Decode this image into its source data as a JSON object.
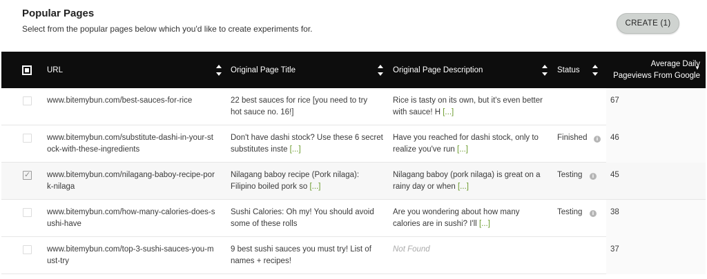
{
  "header": {
    "title": "Popular Pages",
    "subtitle": "Select from the popular pages below which you'd like to create experiments for.",
    "create_label": "CREATE (1)"
  },
  "table": {
    "columns": {
      "url": "URL",
      "title": "Original Page Title",
      "description": "Original Page Description",
      "status": "Status",
      "pageviews_line1": "Average Daily",
      "pageviews_line2": "Pageviews From Google"
    },
    "more_label": "[...]",
    "rows": [
      {
        "checked": false,
        "url_l1": "www.bitemybun.com/best-sauces-for-rice",
        "url_l2": "",
        "title_l1": "22 best sauces for rice [you need to try",
        "title_l2": "hot sauce no. 16!]",
        "title_more": "",
        "desc_l1": "Rice is tasty on its own, but it's even better",
        "desc_l2": "with sauce! H",
        "desc_more": "[...]",
        "status": "",
        "pageviews": "67"
      },
      {
        "checked": false,
        "url_l1": "www.bitemybun.com/substitute-dashi-in-your-st",
        "url_l2": "ock-with-these-ingredients",
        "title_l1": "Don't have dashi stock? Use these 6 secret",
        "title_l2": "substitutes inste",
        "title_more": "[...]",
        "desc_l1": "Have you reached for dashi stock, only to",
        "desc_l2": "realize you've run",
        "desc_more": "[...]",
        "status": "Finished",
        "pageviews": "46"
      },
      {
        "checked": true,
        "url_l1": "www.bitemybun.com/nilagang-baboy-recipe-por",
        "url_l2": "k-nilaga",
        "title_l1": "Nilagang baboy recipe (Pork nilaga):",
        "title_l2": "Filipino boiled pork so",
        "title_more": "[...]",
        "desc_l1": "Nilagang baboy (pork nilaga) is great on a",
        "desc_l2": "rainy day or when",
        "desc_more": "[...]",
        "status": "Testing",
        "pageviews": "45"
      },
      {
        "checked": false,
        "url_l1": "www.bitemybun.com/how-many-calories-does-s",
        "url_l2": "ushi-have",
        "title_l1": "Sushi Calories: Oh my! You should avoid",
        "title_l2": "some of these rolls",
        "title_more": "",
        "desc_l1": "Are you wondering about how many",
        "desc_l2": "calories are in sushi? I'll",
        "desc_more": "[...]",
        "status": "Testing",
        "pageviews": "38"
      },
      {
        "checked": false,
        "url_l1": "www.bitemybun.com/top-3-sushi-sauces-you-m",
        "url_l2": "ust-try",
        "title_l1": "9 best sushi sauces you must try! List of",
        "title_l2": "names + recipes!",
        "title_more": "",
        "desc_l1": "Not Found",
        "desc_l2": "",
        "desc_more": "",
        "status": "",
        "pageviews": "37"
      }
    ]
  },
  "icons": {
    "info": "info-icon",
    "sort": "sort-icon",
    "select_all": "select-all-checkbox"
  },
  "colors": {
    "header_bg": "#0d0d0d",
    "more_link": "#6a9a2b",
    "button_bg": "#cfd3d0"
  }
}
